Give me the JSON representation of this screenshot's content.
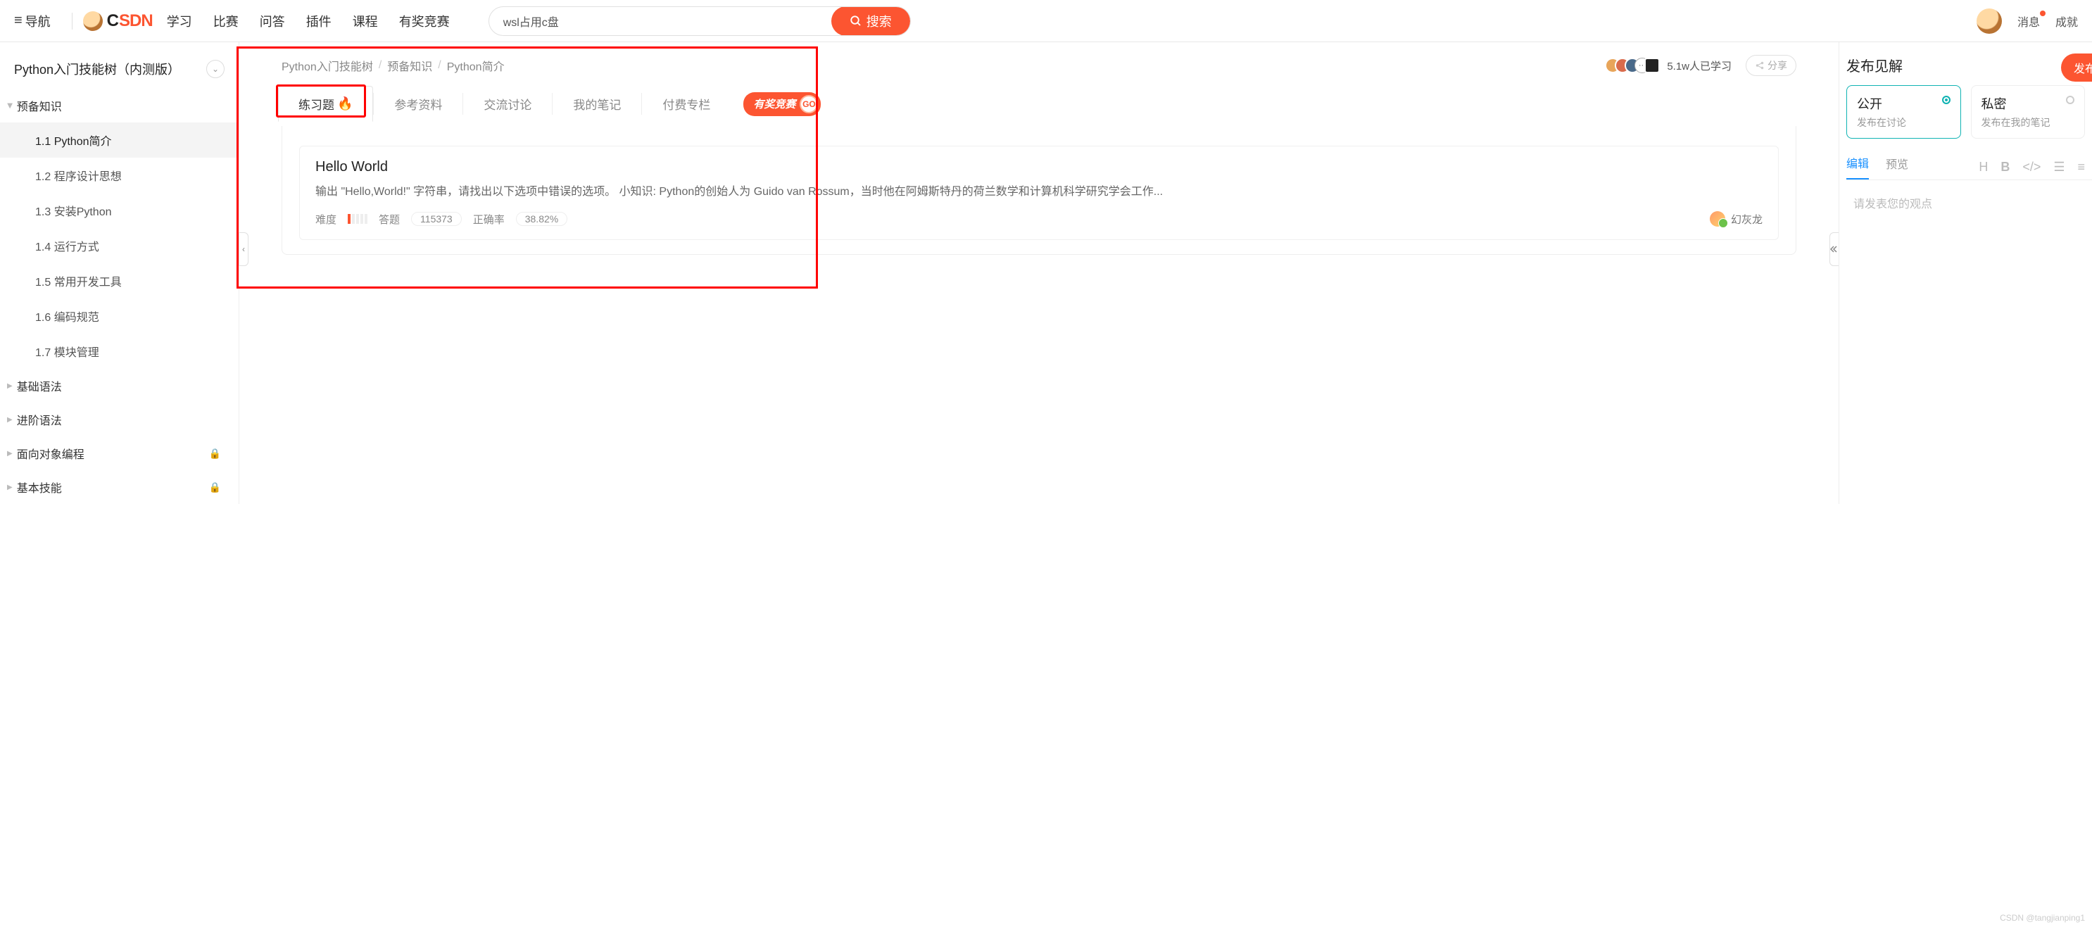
{
  "header": {
    "nav_label": "导航",
    "logo_text": "CSDN",
    "nav_items": [
      "学习",
      "比赛",
      "问答",
      "插件",
      "课程",
      "有奖竞赛"
    ],
    "search_value": "wsl占用c盘",
    "search_btn": "搜索",
    "messages": "消息",
    "achievements": "成就"
  },
  "sidebar": {
    "tree_title": "Python入门技能树（内测版）",
    "groups": [
      {
        "label": "预备知识",
        "open": true,
        "locked": false,
        "items": [
          "1.1 Python简介",
          "1.2 程序设计思想",
          "1.3 安装Python",
          "1.4 运行方式",
          "1.5 常用开发工具",
          "1.6 编码规范",
          "1.7 模块管理"
        ],
        "active_index": 0
      },
      {
        "label": "基础语法",
        "open": false,
        "locked": false,
        "items": []
      },
      {
        "label": "进阶语法",
        "open": false,
        "locked": false,
        "items": []
      },
      {
        "label": "面向对象编程",
        "open": false,
        "locked": true,
        "items": []
      },
      {
        "label": "基本技能",
        "open": false,
        "locked": true,
        "items": []
      }
    ]
  },
  "main": {
    "breadcrumb": [
      "Python入门技能树",
      "预备知识",
      "Python简介"
    ],
    "study_count": "5.1w人已学习",
    "share": "分享",
    "tabs": [
      "练习题",
      "参考资料",
      "交流讨论",
      "我的笔记",
      "付费专栏"
    ],
    "contest": {
      "label": "有奖竞赛",
      "go": "GO"
    },
    "question": {
      "title": "Hello World",
      "desc": "输出 \"Hello,World!\" 字符串，请找出以下选项中错误的选项。 小知识: Python的创始人为 Guido van Rossum，当时他在阿姆斯特丹的荷兰数学和计算机科学研究学会工作...",
      "difficulty_label": "难度",
      "answer_label": "答题",
      "answer_count": "115373",
      "accuracy_label": "正确率",
      "accuracy_value": "38.82%",
      "author": "幻灰龙"
    }
  },
  "right": {
    "title": "发布见解",
    "publish": "发布",
    "visibility": [
      {
        "t": "公开",
        "s": "发布在讨论",
        "active": true
      },
      {
        "t": "私密",
        "s": "发布在我的笔记",
        "active": false
      }
    ],
    "editor_tabs": [
      "编辑",
      "预览"
    ],
    "placeholder": "请发表您的观点"
  },
  "watermark": "CSDN @tangjianping1"
}
